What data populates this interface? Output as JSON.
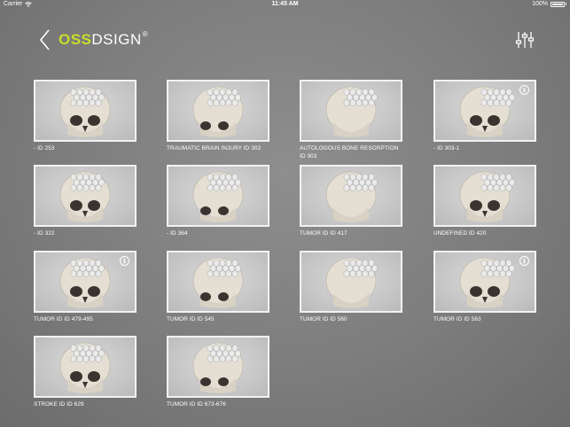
{
  "status_bar": {
    "carrier": "Carrier",
    "time": "11:45 AM",
    "battery": "100%"
  },
  "header": {
    "logo_oss": "OSS",
    "logo_dsign": "DSIGN",
    "logo_reg": "®",
    "back_icon": "chevron-left-icon",
    "filter_icon": "sliders-icon"
  },
  "cases": [
    {
      "label": "- ID 253",
      "info": false
    },
    {
      "label": "TRAUMATIC BRAIN INJURY ID 302",
      "info": false
    },
    {
      "label": "AUTOLOGOUS  BONE RESORPTION ID 303",
      "info": false
    },
    {
      "label": "- ID 303-1",
      "info": true
    },
    {
      "label": "- ID 322",
      "info": false
    },
    {
      "label": "- ID 364",
      "info": false
    },
    {
      "label": "TUMOR ID ID 417",
      "info": false
    },
    {
      "label": "UNDEFINED ID 420",
      "info": false
    },
    {
      "label": "TUMOR ID ID 479-495",
      "info": true
    },
    {
      "label": "TUMOR ID ID 545",
      "info": false
    },
    {
      "label": "TUMOR ID ID 560",
      "info": false
    },
    {
      "label": "TUMOR ID ID 563",
      "info": true
    },
    {
      "label": "STROKE ID ID 629",
      "info": false
    },
    {
      "label": "TUMOR ID ID 673-676",
      "info": false
    }
  ],
  "colors": {
    "accent": "#c8dc2a",
    "background": "#7f7f7f",
    "card_border": "#f2f2f2",
    "bone": "#e4ded3",
    "implant": "#ebebeb"
  }
}
